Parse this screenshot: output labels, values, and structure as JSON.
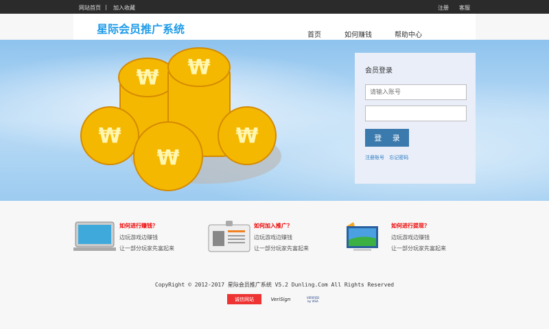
{
  "topbar": {
    "home": "网站首页",
    "sep": "|",
    "favorite": "加入收藏",
    "register": "注册",
    "service": "客服"
  },
  "header": {
    "logo": "星际会员推广系统",
    "nav": [
      "首页",
      "如何赚钱",
      "帮助中心"
    ]
  },
  "login": {
    "title": "会员登录",
    "username_placeholder": "请输入账号",
    "password_value": "",
    "submit": "登 录",
    "register_link": "注册账号",
    "forgot_link": "忘记密码"
  },
  "features": [
    {
      "title": "如何进行赚钱？",
      "line1": "边玩游戏边赚钱",
      "line2": "让一部分玩家先富起来",
      "icon": "laptop-icon"
    },
    {
      "title": "如何加入推广？",
      "line1": "边玩游戏边赚钱",
      "line2": "让一部分玩家先富起来",
      "icon": "id-card-icon"
    },
    {
      "title": "如何进行提现？",
      "line1": "边玩游戏边赚钱",
      "line2": "让一部分玩家先富起来",
      "icon": "monitor-icon"
    }
  ],
  "footer": {
    "copyright": "CopyRight © 2012-2017 星际会员推广系统 V5.2 Dunling.Com All Rights Reserved",
    "badges": [
      "诚信网站",
      "VeriSign",
      "VERIFIED by VISA"
    ]
  },
  "colors": {
    "accent": "#1e9be8",
    "button": "#3b7aad",
    "feature_title": "#e00000"
  }
}
